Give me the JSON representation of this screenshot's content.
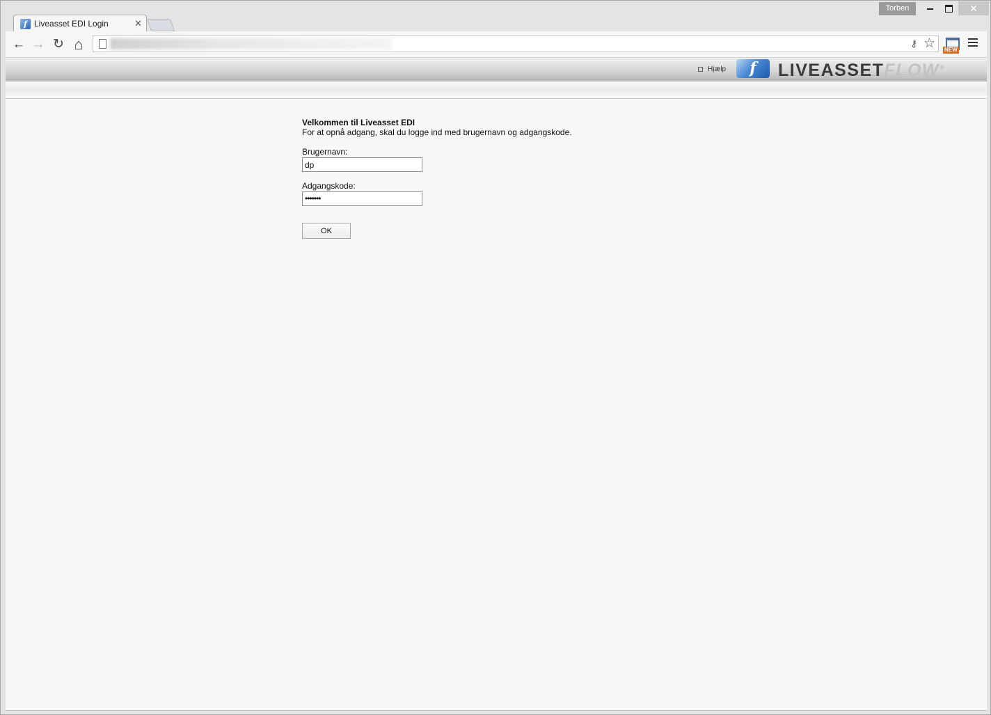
{
  "browser": {
    "profile_name": "Torben",
    "tab_title": "Liveasset EDI Login",
    "tab_close": "✕",
    "nav": {
      "back": "←",
      "forward": "→",
      "reload": "↻",
      "home": "⌂"
    },
    "extension_badge": "NEW"
  },
  "header": {
    "help_label": "Hjælp",
    "logo_mark": "f",
    "logo_main": "LIVEASSET",
    "logo_accent": "FLOW",
    "logo_reg": "®"
  },
  "login": {
    "title": "Velkommen til Liveasset EDI",
    "subtitle": "For at opnå adgang, skal du logge ind med brugernavn og adgangskode.",
    "username_label": "Brugernavn:",
    "username_value": "dp",
    "password_label": "Adgangskode:",
    "password_value": "•••••••",
    "ok_label": "OK"
  },
  "colors": {
    "logo_blue": "#2a63b8",
    "logo_gray_text": "#3a3a3a",
    "logo_flow": "#c2c2c2",
    "page_background": "#f7f7f7"
  }
}
